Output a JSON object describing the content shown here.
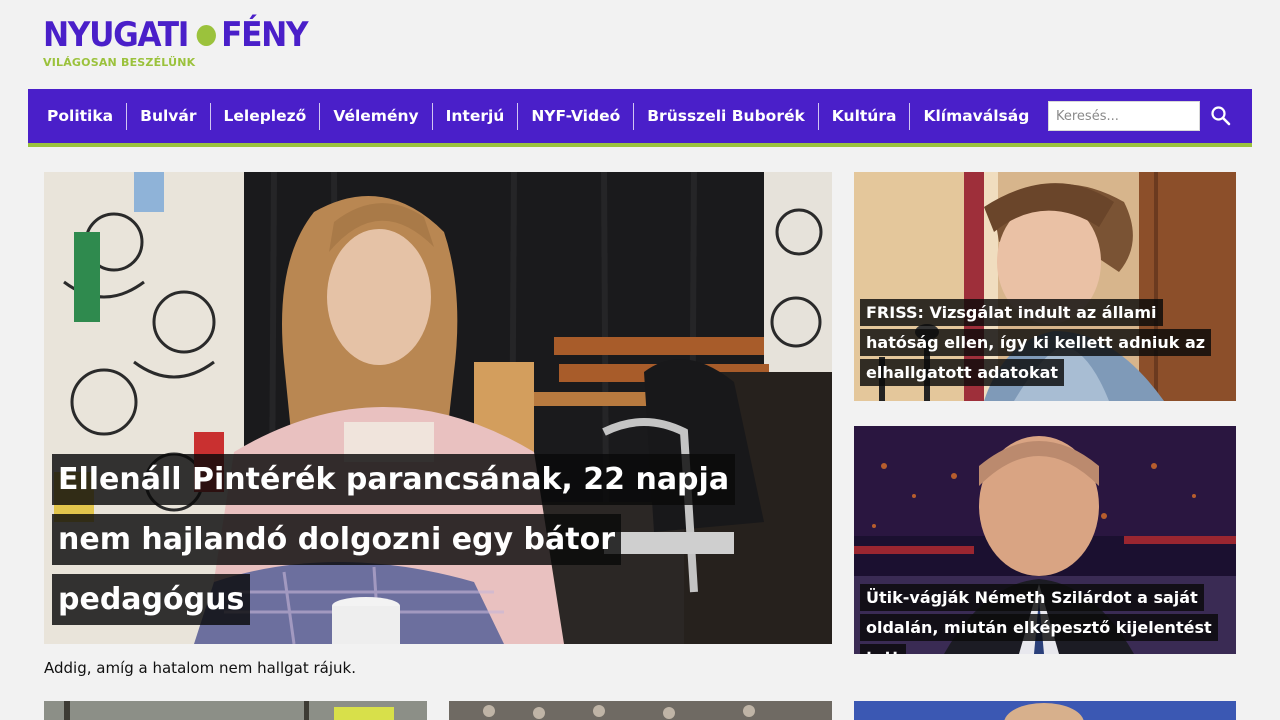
{
  "brand": {
    "name_left": "NYUGATI",
    "name_right": "FÉNY",
    "tagline": "VILÁGOSAN BESZÉLÜNK",
    "primary_color": "#4a1fc9",
    "accent_color": "#9bc23c"
  },
  "nav": {
    "items": [
      {
        "label": "Politika"
      },
      {
        "label": "Bulvár"
      },
      {
        "label": "Leleplező"
      },
      {
        "label": "Vélemény"
      },
      {
        "label": "Interjú"
      },
      {
        "label": "NYF-Videó"
      },
      {
        "label": "Brüsszeli Buborék"
      },
      {
        "label": "Kultúra"
      },
      {
        "label": "Klímaválság"
      }
    ],
    "search": {
      "placeholder": "Keresés...",
      "icon": "search-icon"
    }
  },
  "featured": {
    "title": "Ellenáll Pintérék parancsának, 22 napja nem hajlandó dolgozni egy bátor pedagógus",
    "lead": "Addig, amíg a hatalom nem hallgat rájuk."
  },
  "side_articles": [
    {
      "title": "FRISS: Vizsgálat indult az állami hatóság ellen, így ki kellett adniuk az elhallgatott adatokat"
    },
    {
      "title": "Ütik-vágják Németh Szilárdot a saját oldalán, miután elképesztő kijelentést tett"
    }
  ]
}
